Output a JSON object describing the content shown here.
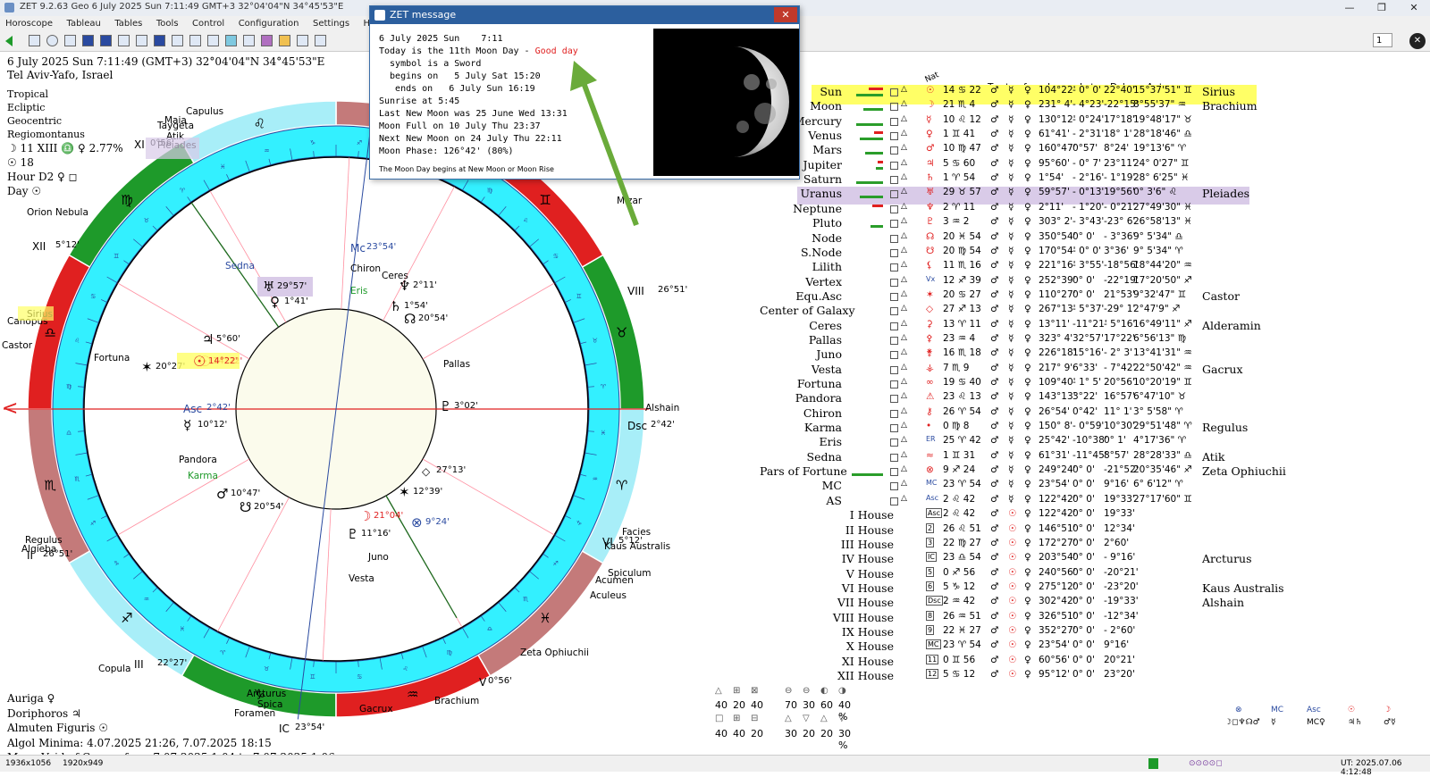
{
  "window": {
    "title": "ZET 9.2.63 Geo      6 July 2025  Sun     7:11:49 GMT+3 32°04'04\"N  34°45'53\"E",
    "buttons": [
      "—",
      "❐",
      "✕"
    ]
  },
  "menu": [
    "Horoscope",
    "Tableau",
    "Tables",
    "Tools",
    "Control",
    "Configuration",
    "Settings",
    "Help"
  ],
  "toolbar": {
    "field_value": "1"
  },
  "chart_header": {
    "line1": "6 July 2025  Sun   7:11:49 (GMT+3) 32°04'04\"N  34°45'53\"E",
    "line2": "Tel Aviv-Yafo, Israel"
  },
  "left_info": [
    "Tropical",
    "Ecliptic",
    "Geocentric",
    "Regiomontanus"
  ],
  "left_info_big": [
    "☽  11 XIII ♎ ♀ 2.77%",
    "☉  18",
    "Hour D2 ♀ ◻",
    "Day ☉"
  ],
  "bottom_left": [
    "Auriga ♀",
    "Doriphoros ♃",
    "Almuten Figuris ☉",
    "Algol Minima: 4.07.2025 21:26,  7.07.2025 18:15",
    "Moon Void of Course from 7.07.2025  1:04 to 7.07.2025  1:06"
  ],
  "popup": {
    "title": "ZET message",
    "close": "✕",
    "line1": "6 July 2025 Sun    7:11",
    "line2a": "Today is the 11th Moon Day - ",
    "line2b": "Good day",
    "line3": "  symbol is a Sword",
    "line4": "  begins on   5 July Sat 15:20",
    "line5": "   ends on   6 July Sun 16:19",
    "line6": "Sunrise at 5:45",
    "line7": "Last New Moon was 25 June Wed 13:31",
    "line8": "Moon Full on 10 July Thu 23:37",
    "line9": "Next New Moon on 24 July Thu 22:11",
    "line10": "Moon Phase: 126°42' (80%)",
    "note": "The Moon Day begins at New Moon or Moon Rise"
  },
  "wheel": {
    "signs_glyphs": [
      "♈",
      "♉",
      "♊",
      "♋",
      "♌",
      "♍",
      "♎",
      "♏",
      "♐",
      "♑",
      "♒",
      "♓"
    ],
    "cusp_labels": [
      {
        "text": "Asc",
        "deg": "2°42'"
      },
      {
        "text": "Mc",
        "deg": "23°54'"
      },
      {
        "text": "Dsc",
        "deg": "2°42'"
      },
      {
        "text": "IC",
        "deg": "23°54'"
      },
      {
        "text": "XII",
        "deg": "5°12'"
      },
      {
        "text": "II",
        "deg": "26°51'"
      },
      {
        "text": "III",
        "deg": "22°27'"
      },
      {
        "text": "V",
        "deg": "0°56'"
      },
      {
        "text": "VI",
        "deg": "5°12'"
      },
      {
        "text": "VIII",
        "deg": "26°51'"
      },
      {
        "text": "IX",
        "deg": "22°27'"
      },
      {
        "text": "XI",
        "deg": "0°56'"
      }
    ],
    "planets": [
      {
        "glyph": "☉",
        "deg": "14°22'"
      },
      {
        "glyph": "♃",
        "deg": "5°60'"
      },
      {
        "glyph": "♅",
        "deg": "29°57'"
      },
      {
        "glyph": "♀",
        "deg": "1°41'"
      },
      {
        "glyph": "♆",
        "deg": "2°11'"
      },
      {
        "glyph": "♄",
        "deg": "1°54'"
      },
      {
        "glyph": "☊",
        "deg": "20°54'"
      },
      {
        "glyph": "♇",
        "deg": "3°02'"
      },
      {
        "glyph": "♂",
        "deg": "10°47'"
      },
      {
        "glyph": "☋",
        "deg": "20°54'"
      },
      {
        "glyph": "☽",
        "deg": "21°04'"
      },
      {
        "glyph": "♇",
        "deg": "11°16'"
      },
      {
        "glyph": "⊗",
        "deg": "9°24'"
      },
      {
        "glyph": "☿",
        "deg": "10°12'"
      },
      {
        "glyph": "✶",
        "deg": "20°27'"
      },
      {
        "glyph": "✶",
        "deg": "12°39'"
      },
      {
        "glyph": "◇",
        "deg": "27°13'"
      }
    ],
    "names": [
      "Sedna",
      "Chiron",
      "Ceres",
      "Eris",
      "Pallas",
      "Fortuna",
      "Pandora",
      "Karma",
      "Juno",
      "Vesta"
    ],
    "stars": [
      "Capulus",
      "Taygeta",
      "Atik",
      "Pleiades",
      "Maia",
      "Orion Nebula",
      "Sirius",
      "Canopus",
      "Castor",
      "Regulus",
      "Algieba",
      "Copula",
      "Arcturus",
      "Spica",
      "Foramen",
      "Gacrux",
      "Brachium",
      "Zeta Ophiuchii",
      "Aculeus",
      "Acumen",
      "Spiculum",
      "Kaus Australis",
      "Facies",
      "Alshain",
      "Mizar",
      "Mirach"
    ]
  },
  "planet_table": {
    "headers": [
      "Nat",
      "T",
      "t",
      "f",
      "Lng",
      "Lat",
      "Dcl",
      "Ant"
    ],
    "rows": [
      {
        "name": "Sun",
        "glyph": "☉",
        "sign": "14 ♋ 22",
        "lng": "104°22'",
        "lat": "- 0° 0'",
        "dcl": "22°40'",
        "ant": "15°37'51\" ♊",
        "star": "Sirius",
        "hl": "yellow"
      },
      {
        "name": "Moon",
        "glyph": "☽",
        "sign": "21 ♏ 4",
        "lng": "231° 4'",
        "lat": "- 4°23'",
        "dcl": "-22°15'",
        "ant": "8°55'37\" ♒",
        "star": "Brachium"
      },
      {
        "name": "Mercury",
        "glyph": "☿",
        "sign": "10 ♌ 12",
        "lng": "130°12'",
        "lat": "- 0°24'",
        "dcl": "17°18'",
        "ant": "19°48'17\" ♉",
        "star": ""
      },
      {
        "name": "Venus",
        "glyph": "♀",
        "sign": "1 ♊ 41",
        "lng": "61°41'",
        "lat": "- 2°31'",
        "dcl": "18° 1'",
        "ant": "28°18'46\" ♎",
        "star": ""
      },
      {
        "name": "Mars",
        "glyph": "♂",
        "sign": "10 ♍ 47",
        "lng": "160°47'",
        "lat": "0°57'",
        "dcl": "8°24'",
        "ant": "19°13'6\" ♈",
        "star": ""
      },
      {
        "name": "Jupiter",
        "glyph": "♃",
        "sign": "5 ♋ 60",
        "lng": "95°60'",
        "lat": "- 0° 7'",
        "dcl": "23°11'",
        "ant": "24° 0'27\" ♊",
        "star": ""
      },
      {
        "name": "Saturn",
        "glyph": "♄",
        "sign": "1 ♈ 54",
        "lng": "1°54'",
        "lat": "- 2°16'",
        "dcl": "- 1°19'",
        "ant": "28° 6'25\" ♓",
        "star": ""
      },
      {
        "name": "Uranus",
        "glyph": "♅",
        "sign": "29 ♉ 57",
        "lng": "59°57'",
        "lat": "- 0°13'",
        "dcl": "19°56'",
        "ant": "0° 3'6\" ♌",
        "star": "Pleiades",
        "hl": "purple"
      },
      {
        "name": "Neptune",
        "glyph": "♆",
        "sign": "2 ♈ 11",
        "lng": "2°11'",
        "lat": "- 1°20'",
        "dcl": "- 0°21'",
        "ant": "27°49'30\" ♓",
        "star": ""
      },
      {
        "name": "Pluto",
        "glyph": "♇",
        "sign": "3 ♒ 2",
        "lng": "303° 2'",
        "lat": "- 3°43'",
        "dcl": "-23° 6'",
        "ant": "26°58'13\" ♓",
        "star": ""
      },
      {
        "name": "Node",
        "glyph": "☊",
        "sign": "20 ♓ 54",
        "lng": "350°54'",
        "lat": "0° 0'",
        "dcl": "- 3°36'",
        "ant": "9° 5'34\" ♎",
        "star": ""
      },
      {
        "name": "S.Node",
        "glyph": "☋",
        "sign": "20 ♍ 54",
        "lng": "170°54'",
        "lat": "- 0° 0'",
        "dcl": "3°36'",
        "ant": "9° 5'34\" ♈",
        "star": ""
      },
      {
        "name": "Lilith",
        "glyph": "⚸",
        "sign": "11 ♏ 16",
        "lng": "221°16'",
        "lat": "- 3°55'",
        "dcl": "-18°56'",
        "ant": "18°44'20\" ♒",
        "star": ""
      },
      {
        "name": "Vertex",
        "glyph": "Vx",
        "sign": "12 ♐ 39",
        "lng": "252°39'",
        "lat": "0° 0'",
        "dcl": "-22°19'",
        "ant": "17°20'50\" ♐",
        "star": ""
      },
      {
        "name": "Equ.Asc",
        "glyph": "✶",
        "sign": "20 ♋ 27",
        "lng": "110°27'",
        "lat": "0° 0'",
        "dcl": "21°53'",
        "ant": "9°32'47\" ♊",
        "star": "Castor"
      },
      {
        "name": "Center of Galaxy",
        "glyph": "◇",
        "sign": "27 ♐ 13",
        "lng": "267°13'",
        "lat": "- 5°37'",
        "dcl": "-29° 1'",
        "ant": "2°47'9\" ♐",
        "star": ""
      },
      {
        "name": "Ceres",
        "glyph": "⚳",
        "sign": "13 ♈ 11",
        "lng": "13°11'",
        "lat": "-11°21'",
        "dcl": "- 5°16'",
        "ant": "16°49'11\" ♐",
        "star": "Alderamin"
      },
      {
        "name": "Pallas",
        "glyph": "⚴",
        "sign": "23 ♒ 4",
        "lng": "323° 4'",
        "lat": "32°57'",
        "dcl": "17°22'",
        "ant": "6°56'13\" ♍",
        "star": ""
      },
      {
        "name": "Juno",
        "glyph": "⚵",
        "sign": "16 ♏ 18",
        "lng": "226°18'",
        "lat": "15°16'",
        "dcl": "- 2° 3'",
        "ant": "13°41'31\" ♒",
        "star": ""
      },
      {
        "name": "Vesta",
        "glyph": "⚶",
        "sign": "7 ♏ 9",
        "lng": "217° 9'",
        "lat": "6°33'",
        "dcl": "- 7°42'",
        "ant": "22°50'42\" ♒",
        "star": "Gacrux"
      },
      {
        "name": "Fortuna",
        "glyph": "∞",
        "sign": "19 ♋ 40",
        "lng": "109°40'",
        "lat": "- 1° 5'",
        "dcl": "20°56'",
        "ant": "10°20'19\" ♊",
        "star": ""
      },
      {
        "name": "Pandora",
        "glyph": "⚠",
        "sign": "23 ♌ 13",
        "lng": "143°13'",
        "lat": "3°22'",
        "dcl": "16°57'",
        "ant": "6°47'10\" ♉",
        "star": ""
      },
      {
        "name": "Chiron",
        "glyph": "⚷",
        "sign": "26 ♈ 54",
        "lng": "26°54'",
        "lat": "0°42'",
        "dcl": "11° 1'",
        "ant": "3° 5'58\" ♈",
        "star": ""
      },
      {
        "name": "Karma",
        "glyph": "•",
        "sign": "0 ♍ 8",
        "lng": "150° 8'",
        "lat": "- 0°59'",
        "dcl": "10°30'",
        "ant": "29°51'48\" ♈",
        "star": "Regulus"
      },
      {
        "name": "Eris",
        "glyph": "ER",
        "sign": "25 ♈ 42",
        "lng": "25°42'",
        "lat": "-10°38'",
        "dcl": "0° 1'",
        "ant": "4°17'36\" ♈",
        "star": ""
      },
      {
        "name": "Sedna",
        "glyph": "≈",
        "sign": "1 ♊ 31",
        "lng": "61°31'",
        "lat": "-11°45'",
        "dcl": "8°57'",
        "ant": "28°28'33\" ♎",
        "star": "Atik"
      },
      {
        "name": "Pars of Fortune",
        "glyph": "⊗",
        "sign": "9 ♐ 24",
        "lng": "249°24'",
        "lat": "0° 0'",
        "dcl": "-21°52'",
        "ant": "20°35'46\" ♐",
        "star": "Zeta Ophiuchii"
      },
      {
        "name": "MC",
        "glyph": "MC",
        "sign": "23 ♈ 54",
        "lng": "23°54'",
        "lat": "0° 0'",
        "dcl": "9°16'",
        "ant": "6° 6'12\" ♈",
        "star": ""
      },
      {
        "name": "AS",
        "glyph": "Asc",
        "sign": "2 ♌ 42",
        "lng": "122°42'",
        "lat": "0° 0'",
        "dcl": "19°33'",
        "ant": "27°17'60\" ♊",
        "star": ""
      }
    ]
  },
  "house_table": [
    {
      "name": "I House",
      "glyph": "Asc",
      "sign": "2 ♌ 42",
      "lng": "122°42'",
      "lat": "0° 0'",
      "dcl": "19°33'",
      "star": ""
    },
    {
      "name": "II House",
      "glyph": "2",
      "sign": "26 ♌ 51",
      "lng": "146°51'",
      "lat": "0° 0'",
      "dcl": "12°34'",
      "star": ""
    },
    {
      "name": "III House",
      "glyph": "3",
      "sign": "22 ♍ 27",
      "lng": "172°27'",
      "lat": "0° 0'",
      "dcl": "2°60'",
      "star": ""
    },
    {
      "name": "IV House",
      "glyph": "IC",
      "sign": "23 ♎ 54",
      "lng": "203°54'",
      "lat": "0° 0'",
      "dcl": "- 9°16'",
      "star": "Arcturus"
    },
    {
      "name": "V House",
      "glyph": "5",
      "sign": "0 ♐ 56",
      "lng": "240°56'",
      "lat": "0° 0'",
      "dcl": "-20°21'",
      "star": ""
    },
    {
      "name": "VI House",
      "glyph": "6",
      "sign": "5 ♑ 12",
      "lng": "275°12'",
      "lat": "0° 0'",
      "dcl": "-23°20'",
      "star": "Kaus Australis"
    },
    {
      "name": "VII House",
      "glyph": "Dsc",
      "sign": "2 ♒ 42",
      "lng": "302°42'",
      "lat": "0° 0'",
      "dcl": "-19°33'",
      "star": "Alshain"
    },
    {
      "name": "VIII House",
      "glyph": "8",
      "sign": "26 ♒ 51",
      "lng": "326°51'",
      "lat": "0° 0'",
      "dcl": "-12°34'",
      "star": ""
    },
    {
      "name": "IX House",
      "glyph": "9",
      "sign": "22 ♓ 27",
      "lng": "352°27'",
      "lat": "0° 0'",
      "dcl": "- 2°60'",
      "star": ""
    },
    {
      "name": "X House",
      "glyph": "MC",
      "sign": "23 ♈ 54",
      "lng": "23°54'",
      "lat": "0° 0'",
      "dcl": "9°16'",
      "star": ""
    },
    {
      "name": "XI House",
      "glyph": "11",
      "sign": "0 ♊ 56",
      "lng": "60°56'",
      "lat": "0° 0'",
      "dcl": "20°21'",
      "star": ""
    },
    {
      "name": "XII House",
      "glyph": "12",
      "sign": "5 ♋ 12",
      "lng": "95°12'",
      "lat": "0° 0'",
      "dcl": "23°20'",
      "star": ""
    }
  ],
  "stats": {
    "row1": [
      "40",
      "20",
      "40"
    ],
    "row2": [
      "40",
      "40",
      "20"
    ],
    "row3": [
      "70",
      "30",
      "60",
      "40 %"
    ],
    "row4": [
      "30",
      "20",
      "20",
      "30 %"
    ]
  },
  "statusbar": {
    "left1": "1936x1056",
    "left2": "1920x949",
    "right": "UT: 2025.07.06  4:12:48"
  },
  "colors": {
    "titlebar": "#e9edf3",
    "popup_title": "#2c5f9e",
    "cyan_ring": "#33f0ff",
    "red": "#e02020",
    "green": "#1e9a2a",
    "rose": "#c47a7a",
    "light_cyan": "#a8eef8",
    "highlight_yellow": "#ffff66",
    "highlight_purple": "#d9cbe8"
  }
}
